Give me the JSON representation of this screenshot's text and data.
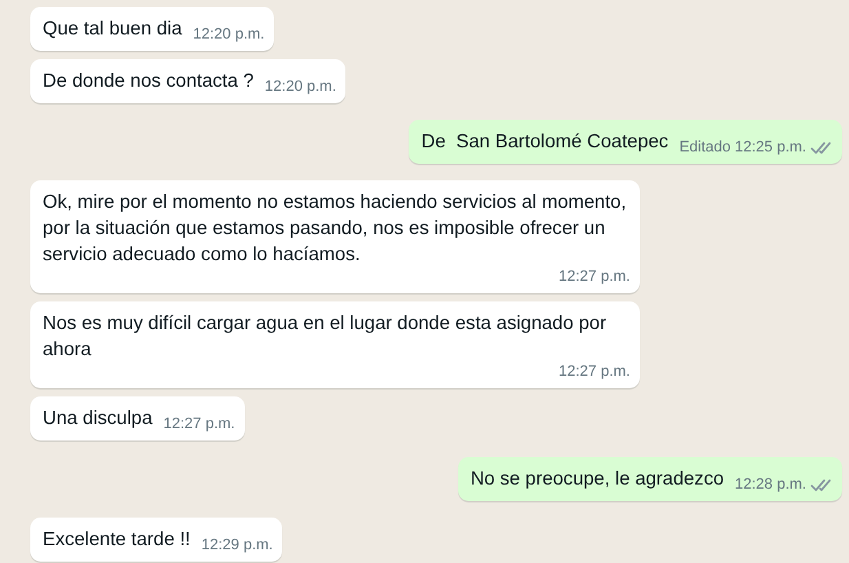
{
  "messages": [
    {
      "kind": "incoming",
      "text": "Que tal buen dia",
      "time": "12:20 p.m."
    },
    {
      "kind": "incoming",
      "text": "De donde nos contacta ?",
      "time": "12:20 p.m."
    },
    {
      "kind": "outgoing",
      "text": "De  San Bartolomé Coatepec",
      "edited_label": "Editado",
      "time": "12:25 p.m.",
      "read": false
    },
    {
      "kind": "incoming",
      "text": "Ok, mire por el momento no estamos haciendo servicios al momento, por la situación que estamos pasando, nos es imposible ofrecer un servicio adecuado como lo hacíamos.",
      "time": "12:27 p.m."
    },
    {
      "kind": "incoming",
      "text": "Nos es muy difícil cargar agua en el lugar donde esta asignado por ahora",
      "time": "12:27 p.m."
    },
    {
      "kind": "incoming",
      "text": "Una disculpa",
      "time": "12:27 p.m."
    },
    {
      "kind": "outgoing",
      "text": "No se preocupe, le agradezco",
      "time": "12:28 p.m.",
      "read": false
    },
    {
      "kind": "incoming",
      "text": "Excelente tarde !!",
      "time": "12:29 p.m."
    }
  ]
}
